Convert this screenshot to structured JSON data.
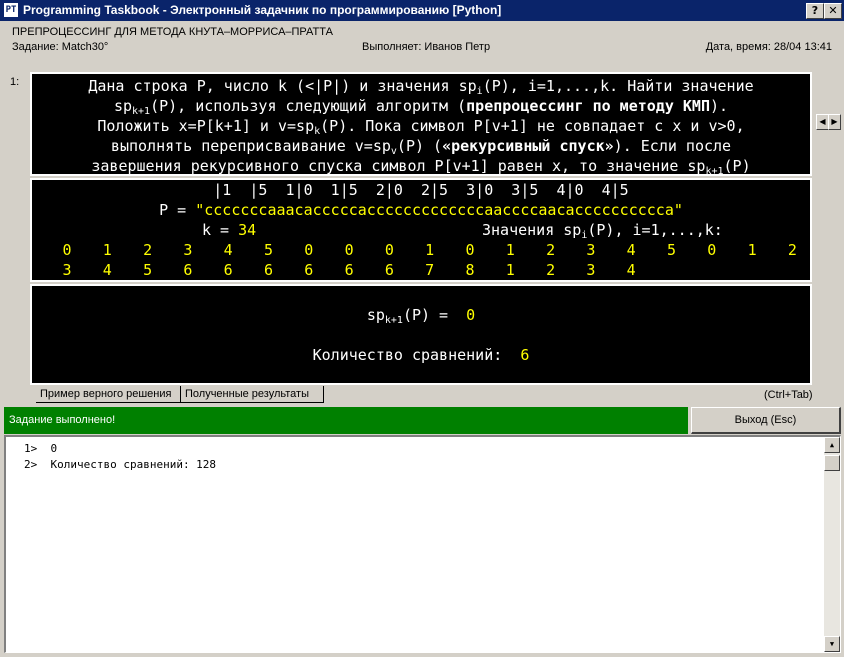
{
  "window": {
    "title": "Programming Taskbook - Электронный задачник по программированию [Python]",
    "icon_label": "PT"
  },
  "header": {
    "title": "ПРЕПРОЦЕССИНГ ДЛЯ МЕТОДА КНУТА–МОРРИСА–ПРАТТА",
    "task": "Задание: Match30°",
    "author": "Выполняет: Иванов Петр",
    "datetime": "Дата, время: 28/04 13:41"
  },
  "task_number": "1:",
  "description": {
    "l1": {
      "a": "Дана строка P, число k (<|P|) и значения sp",
      "sub1": "i",
      "b": "(P), i=1,...,k. Найти значение"
    },
    "l2": {
      "a": "sp",
      "sub1": "k+1",
      "b": "(P), используя следующий алгоритм (",
      "bold": "препроцессинг по методу КМП",
      "c": ")."
    },
    "l3": {
      "a": "Положить x=P[k+1] и v=sp",
      "sub1": "k",
      "b": "(P). Пока символ P[v+1] не совпадает с x и v>0,"
    },
    "l4": {
      "a": "выполнять переприсваивание v=sp",
      "sub1": "v",
      "b": "(P) (",
      "bold": "«рекурсивный спуск»",
      "c": "). Если после"
    },
    "l5": {
      "a": "завершения рекурсивного спуска символ P[v+1] равен x, то значение sp",
      "sub1": "k+1",
      "b": "(P)"
    }
  },
  "input": {
    "ruler": "|1  |5  1|0  1|5  2|0  2|5  3|0  3|5  4|0  4|5",
    "p_label": "P = ",
    "p_value": "\"cccccccaaacacccccacccccccccccccaaccccaacacccccccccca\"",
    "k_label": "k = ",
    "k_value": "34",
    "sp_label_a": "Значения sp",
    "sp_label_sub": "i",
    "sp_label_b": "(P), i=1,...,k:",
    "sp_row1": [
      "0",
      "1",
      "2",
      "3",
      "4",
      "5",
      "0",
      "0",
      "0",
      "1",
      "0",
      "1",
      "2",
      "3",
      "4",
      "5",
      "0",
      "1",
      "2"
    ],
    "sp_row2": [
      "3",
      "4",
      "5",
      "6",
      "6",
      "6",
      "6",
      "6",
      "6",
      "7",
      "8",
      "1",
      "2",
      "3",
      "4"
    ]
  },
  "result": {
    "label_a": "sp",
    "label_sub": "k+1",
    "label_b": "(P) =  ",
    "value": "0",
    "count_label": "Количество сравнений:  ",
    "count_value": "6"
  },
  "tabs": {
    "example": "Пример верного решения",
    "results": "Полученные результаты",
    "hint": "(Ctrl+Tab)"
  },
  "status": {
    "text": "Задание выполнено!",
    "exit": "Выход (Esc)"
  },
  "output": {
    "line1": "1>  0",
    "line2": "2>  Количество сравнений: 128"
  }
}
